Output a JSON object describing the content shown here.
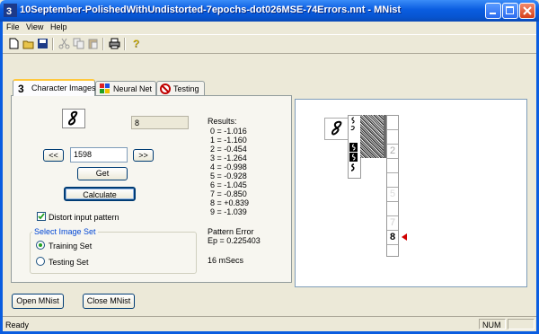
{
  "window": {
    "title": "10September-PolishedWithUndistorted-7epochs-dot026MSE-74Errors.nnt - MNist"
  },
  "menu": {
    "file": "File",
    "view": "View",
    "help": "Help"
  },
  "tabs": [
    {
      "label": "Character Images",
      "active": true
    },
    {
      "label": "Neural Net",
      "active": false
    },
    {
      "label": "Testing",
      "active": false
    }
  ],
  "character": {
    "recognized_value": "8",
    "image_index": "1598",
    "prev_label": "<<",
    "next_label": ">>",
    "get_label": "Get",
    "calculate_label": "Calculate",
    "distort_label": "Distort input pattern",
    "distort_checked": true
  },
  "image_set": {
    "legend": "Select Image Set",
    "training_label": "Training Set",
    "testing_label": "Testing Set",
    "selected": "training"
  },
  "results": {
    "heading": "Results:",
    "lines": [
      "0 = -1.016",
      "1 = -1.160",
      "2 = -0.454",
      "3 = -1.264",
      "4 = -0.998",
      "5 = -0.928",
      "6 = -1.045",
      "7 = -0.850",
      "8 = +0.839",
      "9 = -1.039"
    ],
    "pattern_error_label": "Pattern Error",
    "pattern_error_value": "Ep = 0.225403",
    "timing": "16 mSecs"
  },
  "viewer": {
    "output_column_labels": [
      "2",
      "5",
      "7",
      "8"
    ],
    "highlighted_output": "8",
    "marker_color": "#d00000"
  },
  "buttons": {
    "open": "Open MNist",
    "close": "Close MNist"
  },
  "status": {
    "left": "Ready",
    "num": "NUM"
  }
}
